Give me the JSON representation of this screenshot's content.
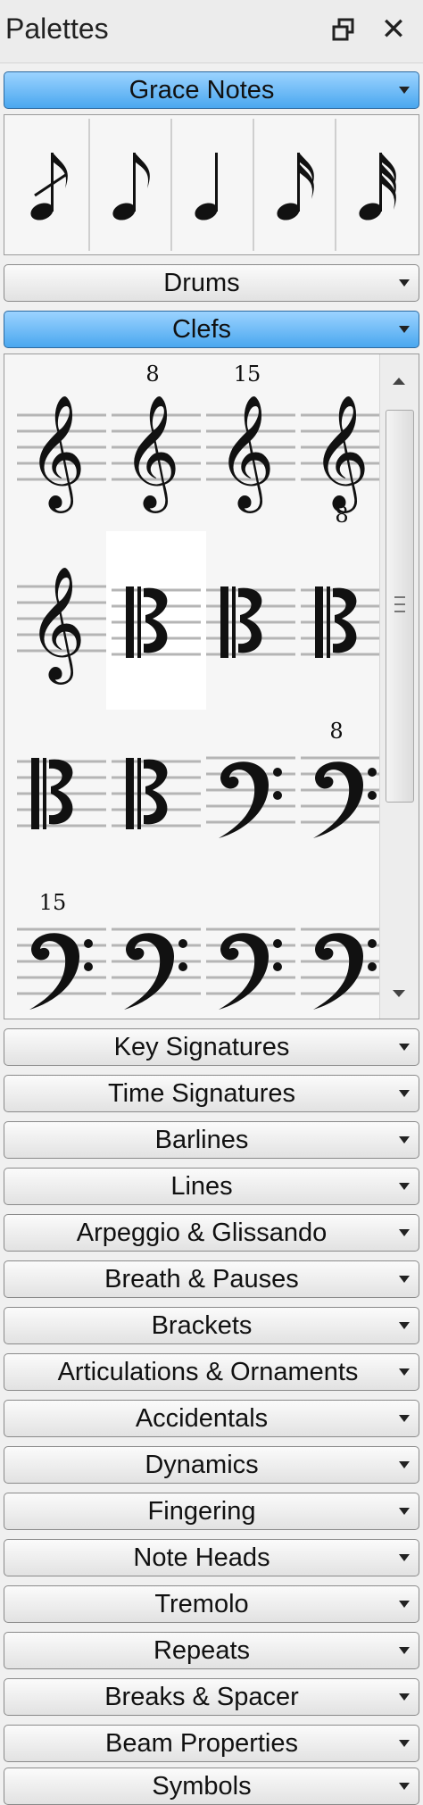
{
  "window": {
    "title": "Palettes"
  },
  "palettes": [
    {
      "label": "Grace Notes",
      "expanded": true
    },
    {
      "label": "Drums",
      "expanded": false
    },
    {
      "label": "Clefs",
      "expanded": true
    },
    {
      "label": "Key Signatures",
      "expanded": false
    },
    {
      "label": "Time Signatures",
      "expanded": false
    },
    {
      "label": "Barlines",
      "expanded": false
    },
    {
      "label": "Lines",
      "expanded": false
    },
    {
      "label": "Arpeggio & Glissando",
      "expanded": false
    },
    {
      "label": "Breath & Pauses",
      "expanded": false
    },
    {
      "label": "Brackets",
      "expanded": false
    },
    {
      "label": "Articulations & Ornaments",
      "expanded": false
    },
    {
      "label": "Accidentals",
      "expanded": false
    },
    {
      "label": "Dynamics",
      "expanded": false
    },
    {
      "label": "Fingering",
      "expanded": false
    },
    {
      "label": "Note Heads",
      "expanded": false
    },
    {
      "label": "Tremolo",
      "expanded": false
    },
    {
      "label": "Repeats",
      "expanded": false
    },
    {
      "label": "Breaks & Spacer",
      "expanded": false
    },
    {
      "label": "Beam Properties",
      "expanded": false
    },
    {
      "label": "Symbols",
      "expanded": false
    }
  ],
  "grace_notes": [
    "acciaccatura",
    "appoggiatura",
    "grace4",
    "grace16",
    "grace32"
  ],
  "clefs": [
    {
      "type": "treble",
      "mark": ""
    },
    {
      "type": "treble",
      "mark": "8"
    },
    {
      "type": "treble",
      "mark": "15"
    },
    {
      "type": "treble",
      "mark": "8",
      "mark_below": true
    },
    {
      "type": "treble",
      "mark": ""
    },
    {
      "type": "c-clef",
      "mark": "",
      "selected": true
    },
    {
      "type": "c-clef",
      "mark": ""
    },
    {
      "type": "c-clef",
      "mark": ""
    },
    {
      "type": "c-clef",
      "mark": ""
    },
    {
      "type": "c-clef",
      "mark": ""
    },
    {
      "type": "bass",
      "mark": ""
    },
    {
      "type": "bass",
      "mark": "8"
    },
    {
      "type": "bass",
      "mark": "15"
    },
    {
      "type": "bass",
      "mark": ""
    },
    {
      "type": "bass",
      "mark": ""
    },
    {
      "type": "bass",
      "mark": ""
    }
  ]
}
